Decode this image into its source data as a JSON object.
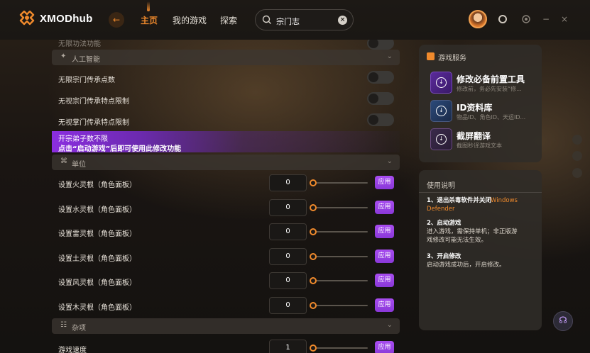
{
  "app": {
    "name": "XMODhub",
    "brand_color": "#f08a2c",
    "accent_purple": "#9b45ea"
  },
  "topbar": {
    "back_icon": "arrow-left-icon",
    "nav": [
      {
        "label": "主页",
        "active": true
      },
      {
        "label": "我的游戏",
        "active": false
      },
      {
        "label": "探索",
        "active": false
      }
    ],
    "search": {
      "value": "宗门志",
      "icon": "search-icon",
      "clear_icon": "clear-icon"
    },
    "right_icons": [
      "avatar",
      "notification-icon",
      "settings-icon",
      "minimize-icon",
      "close-icon"
    ]
  },
  "main": {
    "partial_top_label": "无限功法功能",
    "sections": [
      {
        "id": "ai",
        "label": "人工智能",
        "icon": "ai-icon"
      },
      {
        "id": "unit",
        "label": "单位",
        "icon": "unit-icon"
      },
      {
        "id": "misc",
        "label": "杂项",
        "icon": "misc-icon"
      }
    ],
    "toggles": [
      {
        "label": "无限宗门传承点数",
        "on": false
      },
      {
        "label": "无视宗门传承特点限制",
        "on": false
      },
      {
        "label": "无视掌门传承特点限制",
        "on": false
      }
    ],
    "banner": {
      "line1": "开宗弟子数不限",
      "line2": "点击“启动游戏”后即可使用此修改功能"
    },
    "unit_rows": [
      {
        "label": "设置火灵根（角色面板）",
        "value": "0",
        "slider": 0.0,
        "button": "应用"
      },
      {
        "label": "设置水灵根（角色面板）",
        "value": "0",
        "slider": 0.0,
        "button": "应用"
      },
      {
        "label": "设置雷灵根（角色面板）",
        "value": "0",
        "slider": 0.0,
        "button": "应用"
      },
      {
        "label": "设置土灵根（角色面板）",
        "value": "0",
        "slider": 0.0,
        "button": "应用"
      },
      {
        "label": "设置风灵根（角色面板）",
        "value": "0",
        "slider": 0.0,
        "button": "应用"
      },
      {
        "label": "设置木灵根（角色面板）",
        "value": "0",
        "slider": 0.0,
        "button": "应用"
      }
    ],
    "misc_rows": [
      {
        "label": "游戏速度",
        "value": "1",
        "slider": 0.0,
        "button": "应用"
      }
    ]
  },
  "services": {
    "title": "游戏服务",
    "items": [
      {
        "title": "修改必备前置工具",
        "subtitle": "修改前，务必先安装“修..."
      },
      {
        "title": "ID资料库",
        "subtitle": "物品ID、角色ID、天运ID..."
      },
      {
        "title": "截屏翻译",
        "subtitle": "截图秒译游戏文本"
      }
    ]
  },
  "instructions": {
    "title": "使用说明",
    "steps": [
      {
        "heading": "1、退出杀毒软件并关闭",
        "highlight": "Windows Defender",
        "body": ""
      },
      {
        "heading": "2、启动游戏",
        "highlight": "",
        "body": "进入游戏，需保持单机；非正版游戏修改可能无法生效。"
      },
      {
        "heading": "3、开启修改",
        "highlight": "",
        "body": "启动游戏成功后，开启修改。"
      }
    ]
  },
  "float_button_icon": "headset-icon"
}
